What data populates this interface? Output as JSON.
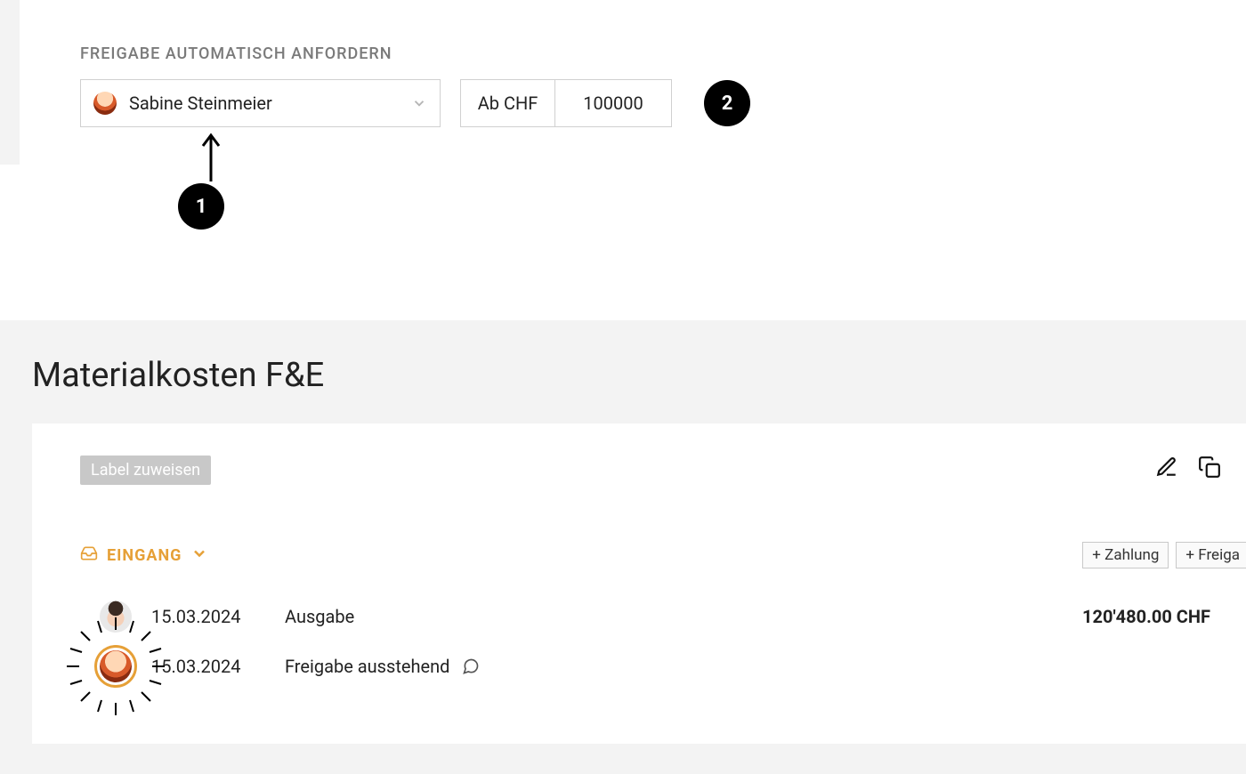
{
  "approval": {
    "section_label": "FREIGABE AUTOMATISCH ANFORDERN",
    "person_name": "Sabine Steinmeier",
    "amount_prefix": "Ab CHF",
    "amount_value": "100000"
  },
  "annotations": {
    "badge1": "1",
    "badge2": "2"
  },
  "page": {
    "title": "Materialkosten F&E"
  },
  "card": {
    "label_chip": "Label zuweisen",
    "inbox_label": "EINGANG",
    "buttons": {
      "payment": "+ Zahlung",
      "approval": "+ Freiga"
    }
  },
  "entries": [
    {
      "date": "15.03.2024",
      "label": "Ausgabe",
      "amount": "120'480.00 CHF"
    },
    {
      "date": "15.03.2024",
      "label": "Freigabe ausstehend"
    }
  ]
}
